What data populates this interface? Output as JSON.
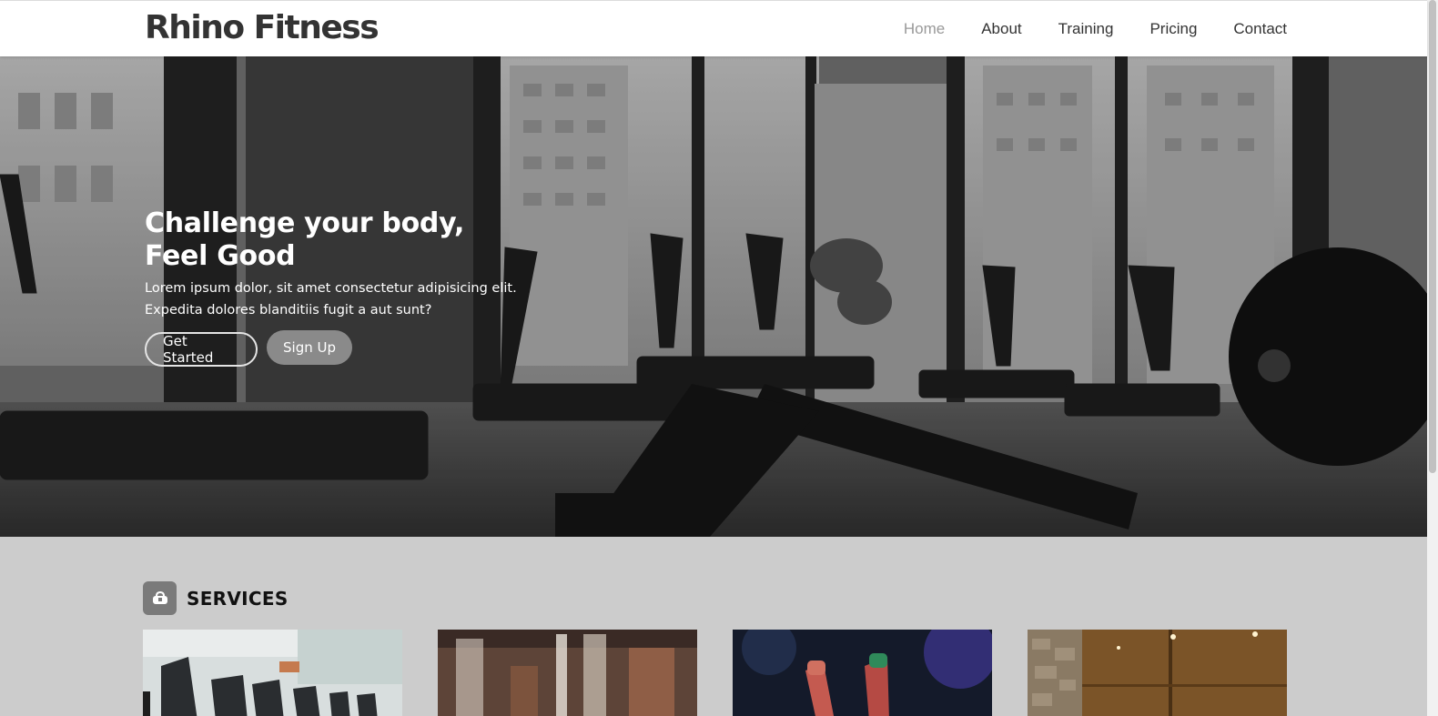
{
  "brand": {
    "name": "Rhino Fitness"
  },
  "nav": {
    "items": [
      {
        "label": "Home",
        "active": true
      },
      {
        "label": "About",
        "active": false
      },
      {
        "label": "Training",
        "active": false
      },
      {
        "label": "Pricing",
        "active": false
      },
      {
        "label": "Contact",
        "active": false
      }
    ]
  },
  "hero": {
    "title_line1": "Challenge your body,",
    "title_line2": "Feel Good",
    "subtitle_line1": "Lorem ipsum dolor, sit amet consectetur adipisicing elit.",
    "subtitle_line2": "Expedita dolores blanditiis fugit a aut sunt?",
    "primary_button": "Get Started",
    "secondary_button": "Sign Up"
  },
  "services": {
    "heading": "SERVICES",
    "icon": "dumbbell-bag-icon",
    "cards": [
      {
        "image": "gym-treadmills-image"
      },
      {
        "image": "blurred-gym-interior-image"
      },
      {
        "image": "raised-fists-concert-image"
      },
      {
        "image": "sauna-room-image"
      }
    ]
  },
  "colors": {
    "header_bg": "#ffffff",
    "text_dark": "#333333",
    "nav_active": "#999999",
    "services_bg": "#cccccc",
    "button_filled": "#8a8a8a"
  }
}
